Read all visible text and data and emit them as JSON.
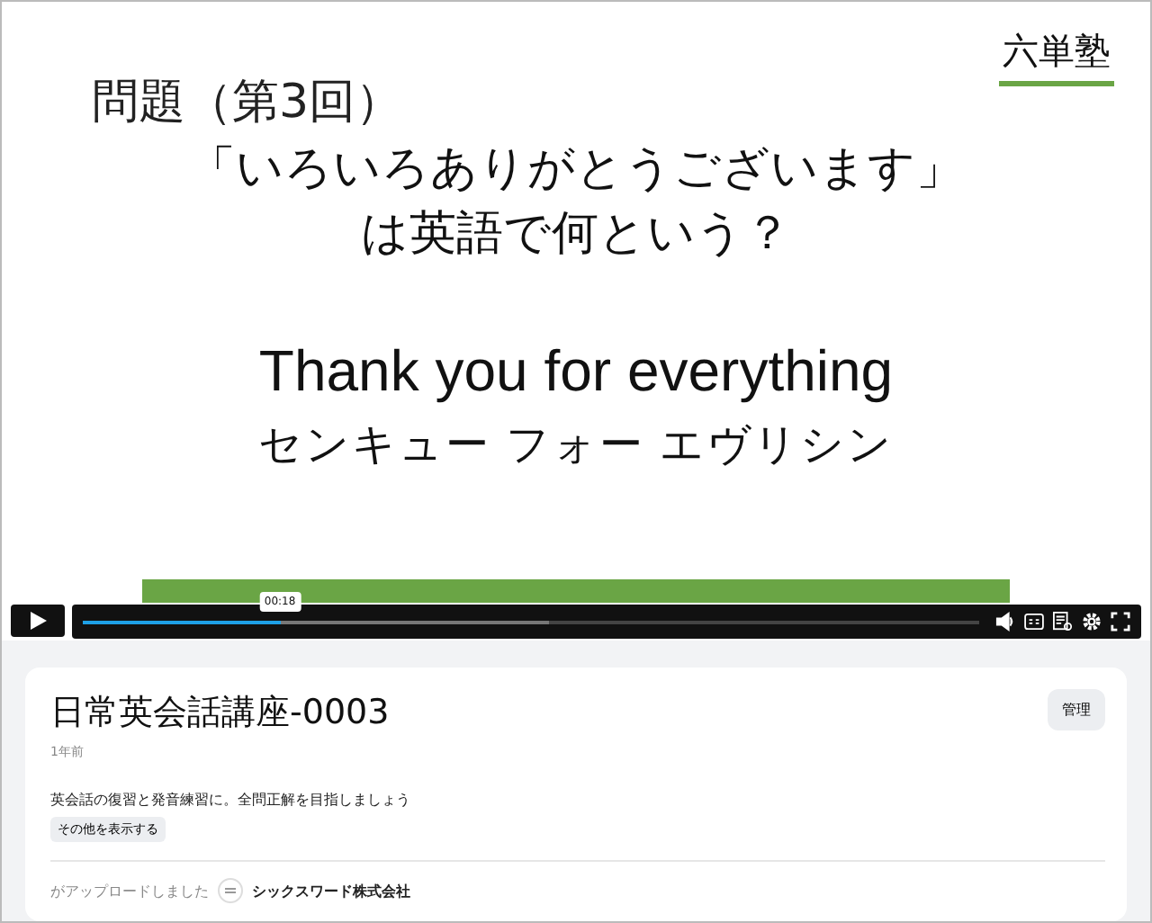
{
  "slide": {
    "logo": "六単塾",
    "heading": "問題（第3回）",
    "question": [
      "「いろいろありがとうございます」",
      "は英語で何という？"
    ],
    "answer": "Thank you for everything",
    "reading": "センキュー フォー エヴリシン"
  },
  "player": {
    "time": "00:18",
    "progress": {
      "level": 0.22
    },
    "buffer": {
      "level": 0.52
    }
  },
  "video_info": {
    "title": "日常英会話講座-0003",
    "manage_button": "管理",
    "age": "1年前",
    "description": "英会話の復習と発音練習に。全問正解を目指しましょう",
    "show_more_button": "その他を表示する",
    "uploaded_label": "がアップロードしました",
    "channel": "シックスワード株式会社"
  }
}
